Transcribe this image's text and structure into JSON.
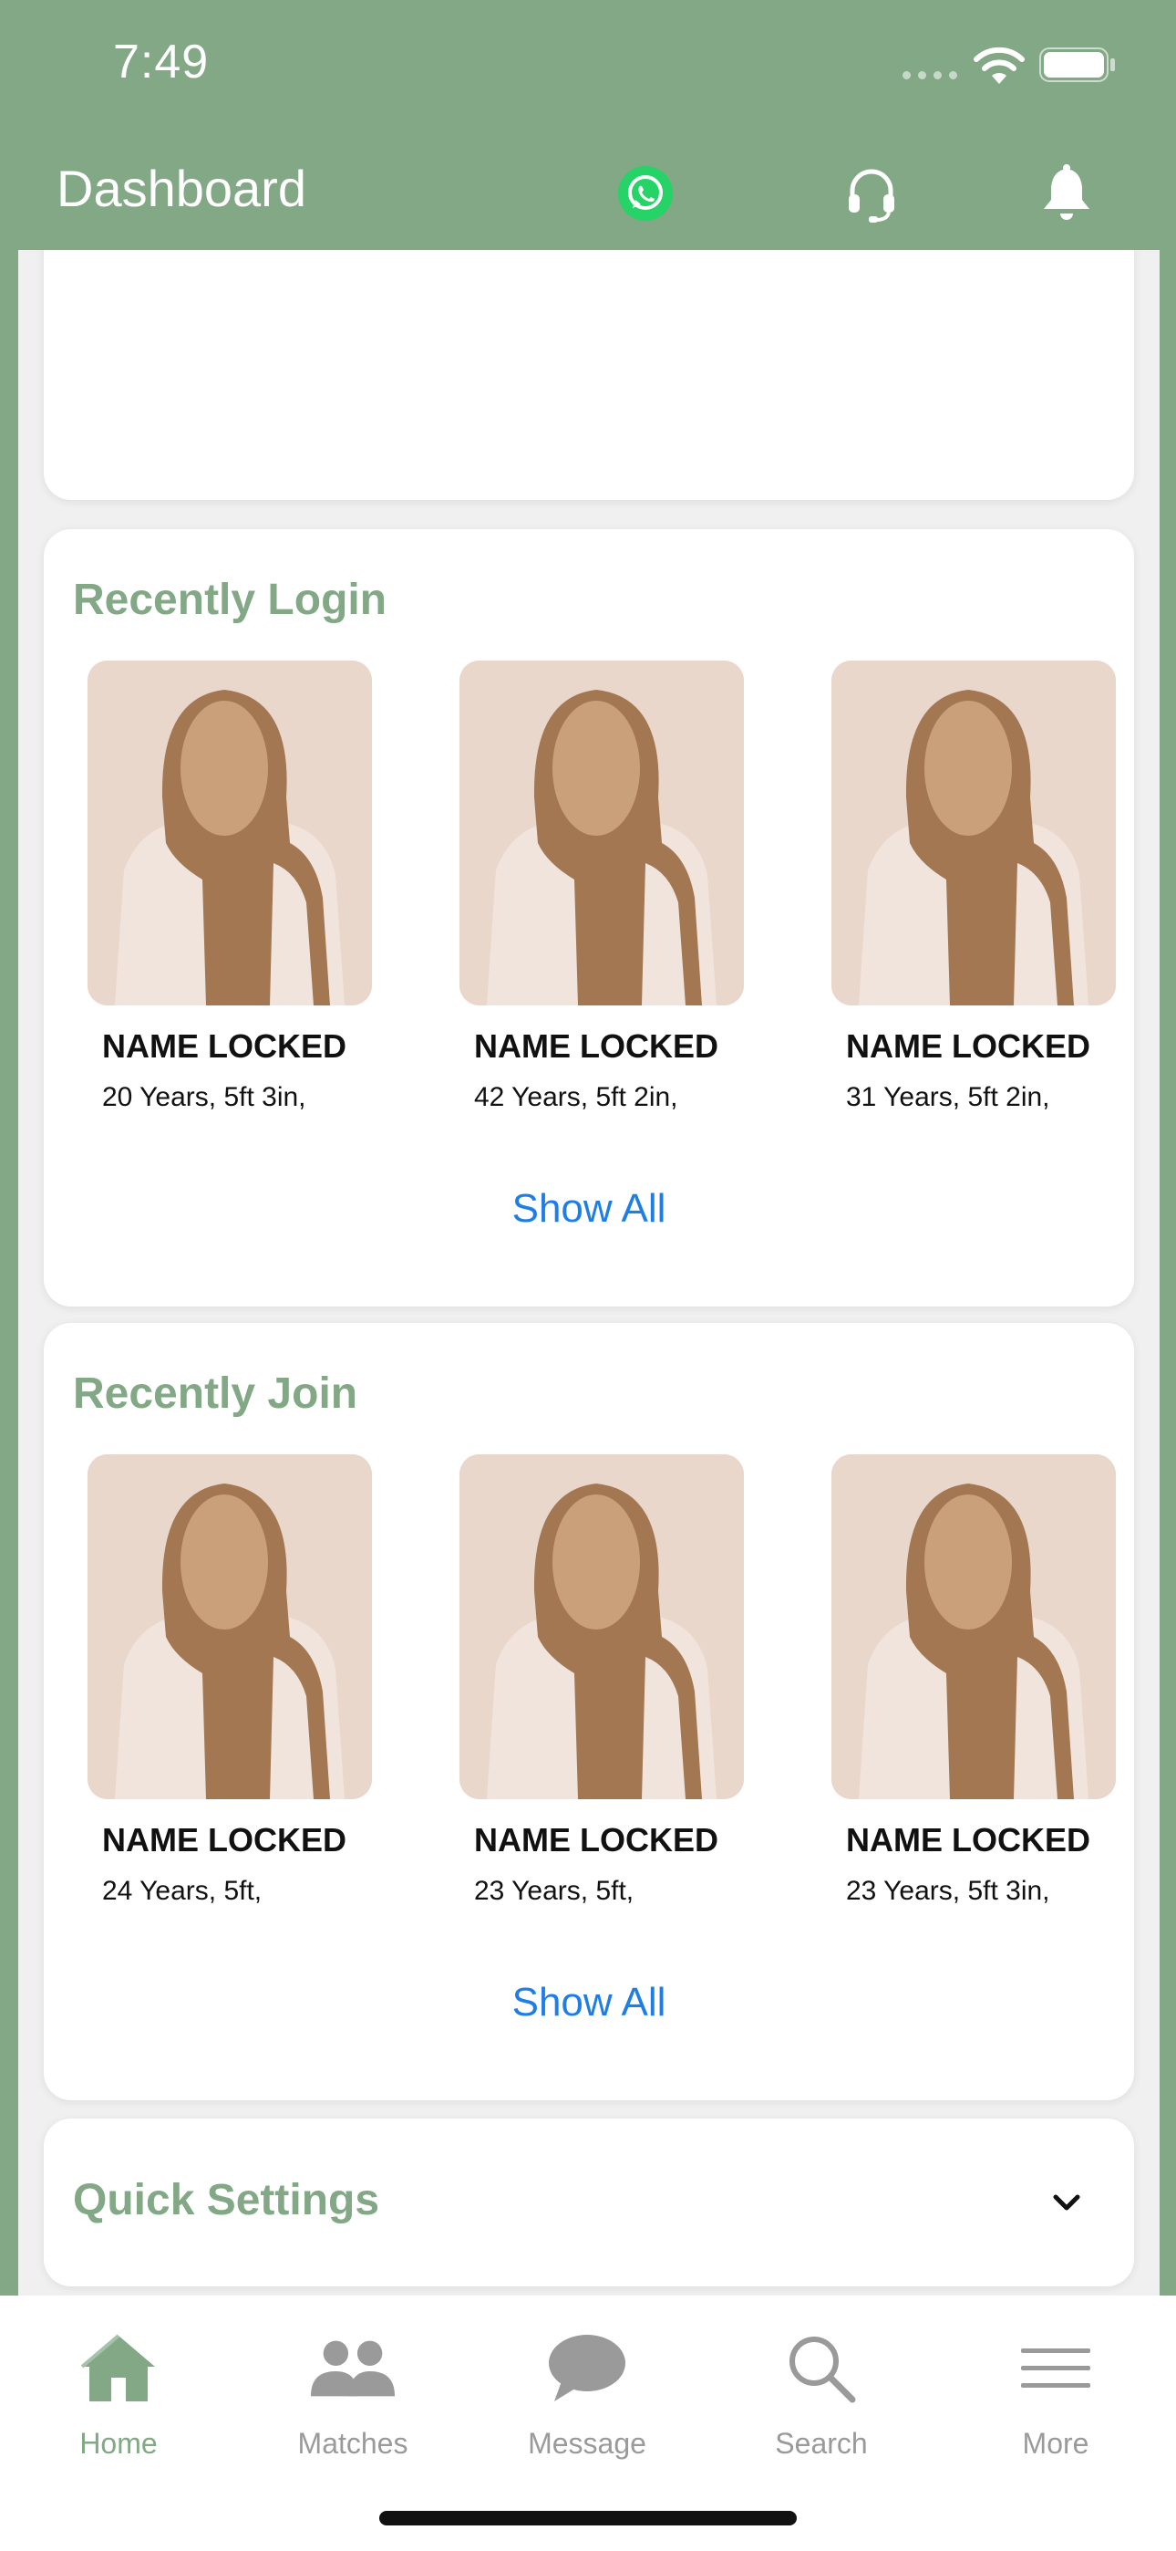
{
  "status_bar": {
    "time": "7:49"
  },
  "header": {
    "title": "Dashboard",
    "icons": [
      "whatsapp-icon",
      "headset-icon",
      "bell-icon"
    ]
  },
  "sections": {
    "recently_login": {
      "title": "Recently Login",
      "show_all_label": "Show All",
      "profiles": [
        {
          "name": "NAME LOCKED",
          "meta": "20 Years, 5ft 3in,"
        },
        {
          "name": "NAME LOCKED",
          "meta": "42 Years, 5ft 2in,"
        },
        {
          "name": "NAME LOCKED",
          "meta": "31 Years, 5ft 2in,"
        }
      ]
    },
    "recently_join": {
      "title": "Recently Join",
      "show_all_label": "Show All",
      "profiles": [
        {
          "name": "NAME LOCKED",
          "meta": "24 Years, 5ft,"
        },
        {
          "name": "NAME LOCKED",
          "meta": "23 Years, 5ft,"
        },
        {
          "name": "NAME LOCKED",
          "meta": "23 Years, 5ft 3in,"
        }
      ]
    },
    "quick_settings": {
      "title": "Quick Settings"
    }
  },
  "tab_bar": {
    "tabs": [
      {
        "label": "Home",
        "icon": "home-icon",
        "active": true
      },
      {
        "label": "Matches",
        "icon": "people-icon",
        "active": false
      },
      {
        "label": "Message",
        "icon": "chat-bubble-icon",
        "active": false
      },
      {
        "label": "Search",
        "icon": "search-icon",
        "active": false
      },
      {
        "label": "More",
        "icon": "menu-icon",
        "active": false
      }
    ]
  },
  "colors": {
    "brand_green": "#83a886",
    "link_blue": "#1e7ee6",
    "whatsapp_green": "#25d366"
  }
}
